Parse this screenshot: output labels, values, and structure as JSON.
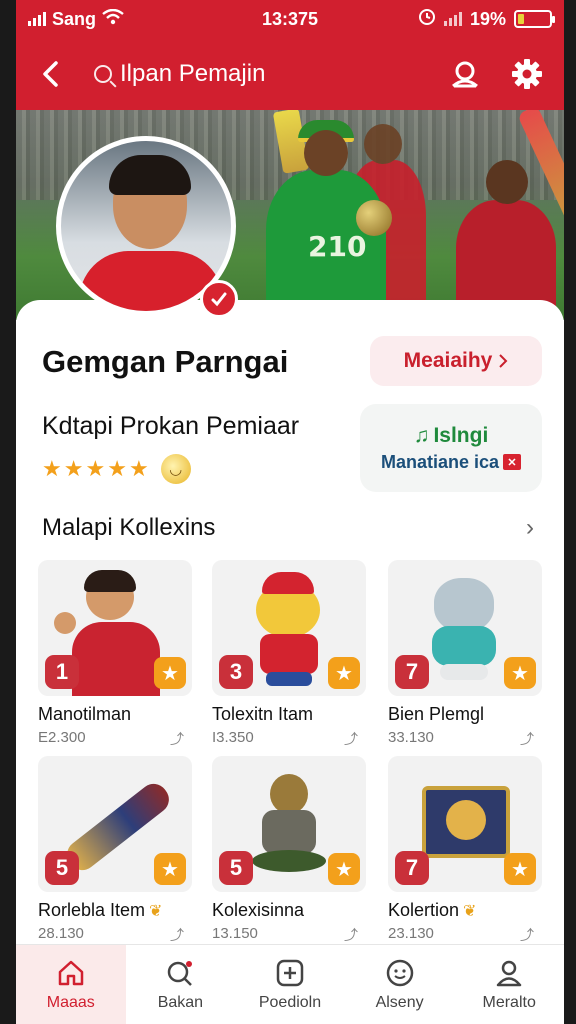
{
  "status_bar": {
    "carrier": "Sang",
    "time": "13:375",
    "battery_text": "19%",
    "battery_level": 0.19
  },
  "header": {
    "search_placeholder": "Ilpan Pemajin",
    "icons": [
      "back-icon",
      "search-icon",
      "avatar-outline-icon",
      "gear-icon"
    ]
  },
  "profile": {
    "name": "Gemgan Parngai",
    "follow_label": "Meaiaihy",
    "subtitle": "Kdtapi Prokan Pemiaar",
    "rating_stars": 5,
    "promo": {
      "top_text": "Islngi",
      "bottom_text": "Manatiane ica"
    }
  },
  "collection": {
    "title": "Malapi Kollexins",
    "items": [
      {
        "rank": "1",
        "name": "Manotilman",
        "price": "E2.300",
        "heart": false
      },
      {
        "rank": "3",
        "name": "Tolexitn Itam",
        "price": "I3.350",
        "heart": false
      },
      {
        "rank": "7",
        "name": "Bien Plemgl",
        "price": "33.130",
        "heart": false
      },
      {
        "rank": "5",
        "name": "Rorlebla Item",
        "price": "28.130",
        "heart": true
      },
      {
        "rank": "5",
        "name": "Kolexisinna",
        "price": "13.150",
        "heart": false
      },
      {
        "rank": "7",
        "name": "Kolertion",
        "price": "23.130",
        "heart": true
      }
    ]
  },
  "tab_bar": {
    "tabs": [
      {
        "label": "Maaas",
        "icon": "home-icon"
      },
      {
        "label": "Bakan",
        "icon": "search-bell-icon"
      },
      {
        "label": "Poedioln",
        "icon": "add-box-icon"
      },
      {
        "label": "Alseny",
        "icon": "chat-face-icon"
      },
      {
        "label": "Meralto",
        "icon": "profile-icon"
      }
    ],
    "active_index": 0
  },
  "colors": {
    "brand_red": "#d11f2f",
    "star_orange": "#f3a01b",
    "promo_green": "#1f8a3c",
    "promo_blue": "#1b4f7a"
  }
}
